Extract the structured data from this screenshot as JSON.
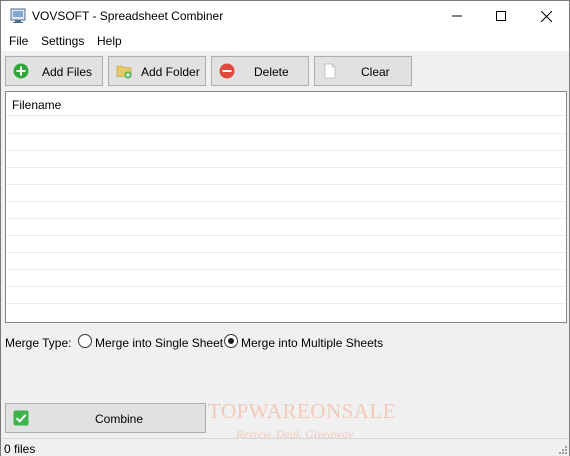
{
  "window": {
    "title": "VOVSOFT - Spreadsheet Combiner"
  },
  "menu": {
    "file": "File",
    "settings": "Settings",
    "help": "Help"
  },
  "toolbar": {
    "add_files": "Add Files",
    "add_folder": "Add Folder",
    "delete": "Delete",
    "clear": "Clear"
  },
  "filelist": {
    "column_header": "Filename",
    "rows": []
  },
  "merge": {
    "label": "Merge Type:",
    "options": [
      {
        "label": "Merge into Single Sheet",
        "selected": false
      },
      {
        "label": "Merge into Multiple Sheets",
        "selected": true
      }
    ]
  },
  "combine": {
    "label": "Combine"
  },
  "watermark": {
    "main": "TOPWAREONSALE",
    "sub": "Review. Deal. Giveaway"
  },
  "status": {
    "text": "0 files"
  },
  "colors": {
    "add_green": "#2fa83a",
    "delete_red": "#e0483a",
    "folder_yellow": "#e8c766",
    "combine_green": "#3bb54a"
  }
}
